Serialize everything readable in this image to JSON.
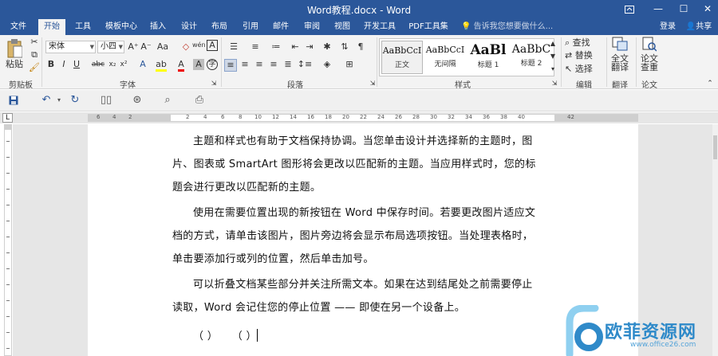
{
  "window": {
    "title": "Word教程.docx - Word",
    "restore_icon": "ribbon-display-icon",
    "minimize": "—",
    "maximize": "☐",
    "close": "✕"
  },
  "tabs": [
    {
      "label": "文件",
      "active": false
    },
    {
      "label": "开始",
      "active": true
    },
    {
      "label": "工具",
      "active": false
    },
    {
      "label": "模板中心",
      "active": false
    },
    {
      "label": "插入",
      "active": false
    },
    {
      "label": "设计",
      "active": false
    },
    {
      "label": "布局",
      "active": false
    },
    {
      "label": "引用",
      "active": false
    },
    {
      "label": "邮件",
      "active": false
    },
    {
      "label": "审阅",
      "active": false
    },
    {
      "label": "视图",
      "active": false
    },
    {
      "label": "开发工具",
      "active": false
    },
    {
      "label": "PDF工具集",
      "active": false
    }
  ],
  "tell_me": "告诉我您想要做什么...",
  "account": {
    "signin": "登录",
    "share": "共享"
  },
  "ribbon": {
    "clipboard": {
      "label": "剪贴板",
      "paste": "粘贴"
    },
    "font": {
      "label": "字体",
      "font_name": "宋体",
      "font_size": "小四",
      "bold": "B",
      "italic": "I",
      "underline": "U",
      "strike": "abc",
      "subscript": "x₂",
      "superscript": "x²",
      "grow": "A⁺",
      "shrink": "A⁻",
      "case": "Aa",
      "wen": "wén",
      "char_border": "A",
      "font_color": "A",
      "char_shading": "A",
      "circle": "字"
    },
    "paragraph": {
      "label": "段落"
    },
    "styles": {
      "label": "样式",
      "items": [
        {
          "sample": "AaBbCcI",
          "name": "正文",
          "selected": true
        },
        {
          "sample": "AaBbCcI",
          "name": "无间隔",
          "selected": false
        },
        {
          "sample": "AaBl",
          "name": "标题 1",
          "selected": false
        },
        {
          "sample": "AaBbC",
          "name": "标题 2",
          "selected": false
        }
      ]
    },
    "editing": {
      "label": "编辑",
      "find": "查找",
      "replace": "替换",
      "select": "选择"
    },
    "translate": {
      "label": "翻译",
      "full_translate": [
        "全文",
        "翻译"
      ]
    },
    "paper": {
      "label": "论文",
      "check": [
        "论文",
        "查重"
      ]
    }
  },
  "document": {
    "paragraphs": [
      [
        "主题和样式也有助于文档保持协调。当您单击设计并选择新的主题时，图",
        "片、图表或 SmartArt 图形将会更改以匹配新的主题。当应用样式时，您的标",
        "题会进行更改以匹配新的主题。"
      ],
      [
        "使用在需要位置出现的新按钮在 Word 中保存时间。若要更改图片适应文",
        "档的方式，请单击该图片，图片旁边将会显示布局选项按钮。当处理表格时，",
        "单击要添加行或列的位置，然后单击加号。"
      ],
      [
        "可以折叠文档某些部分并关注所需文本。如果在达到结尾处之前需要停止",
        "读取，Word 会记住您的停止位置 —— 即使在另一个设备上。"
      ]
    ],
    "last_line": "（ ）    （ ）"
  },
  "ruler": {
    "numbers": [
      "2",
      "4",
      "6",
      "8",
      "10",
      "12",
      "14",
      "16",
      "18",
      "20",
      "22",
      "24",
      "26",
      "28",
      "30",
      "32",
      "34",
      "36",
      "38",
      "40",
      "42"
    ],
    "corner": "L"
  },
  "watermark": {
    "text": "欧菲资源网",
    "url": "www.office26.com"
  },
  "colors": {
    "brand": "#2b579a",
    "ribbon_bg": "#f3f3f3",
    "workspace": "#e6e6e6",
    "watermark": "#2f8ac9"
  }
}
